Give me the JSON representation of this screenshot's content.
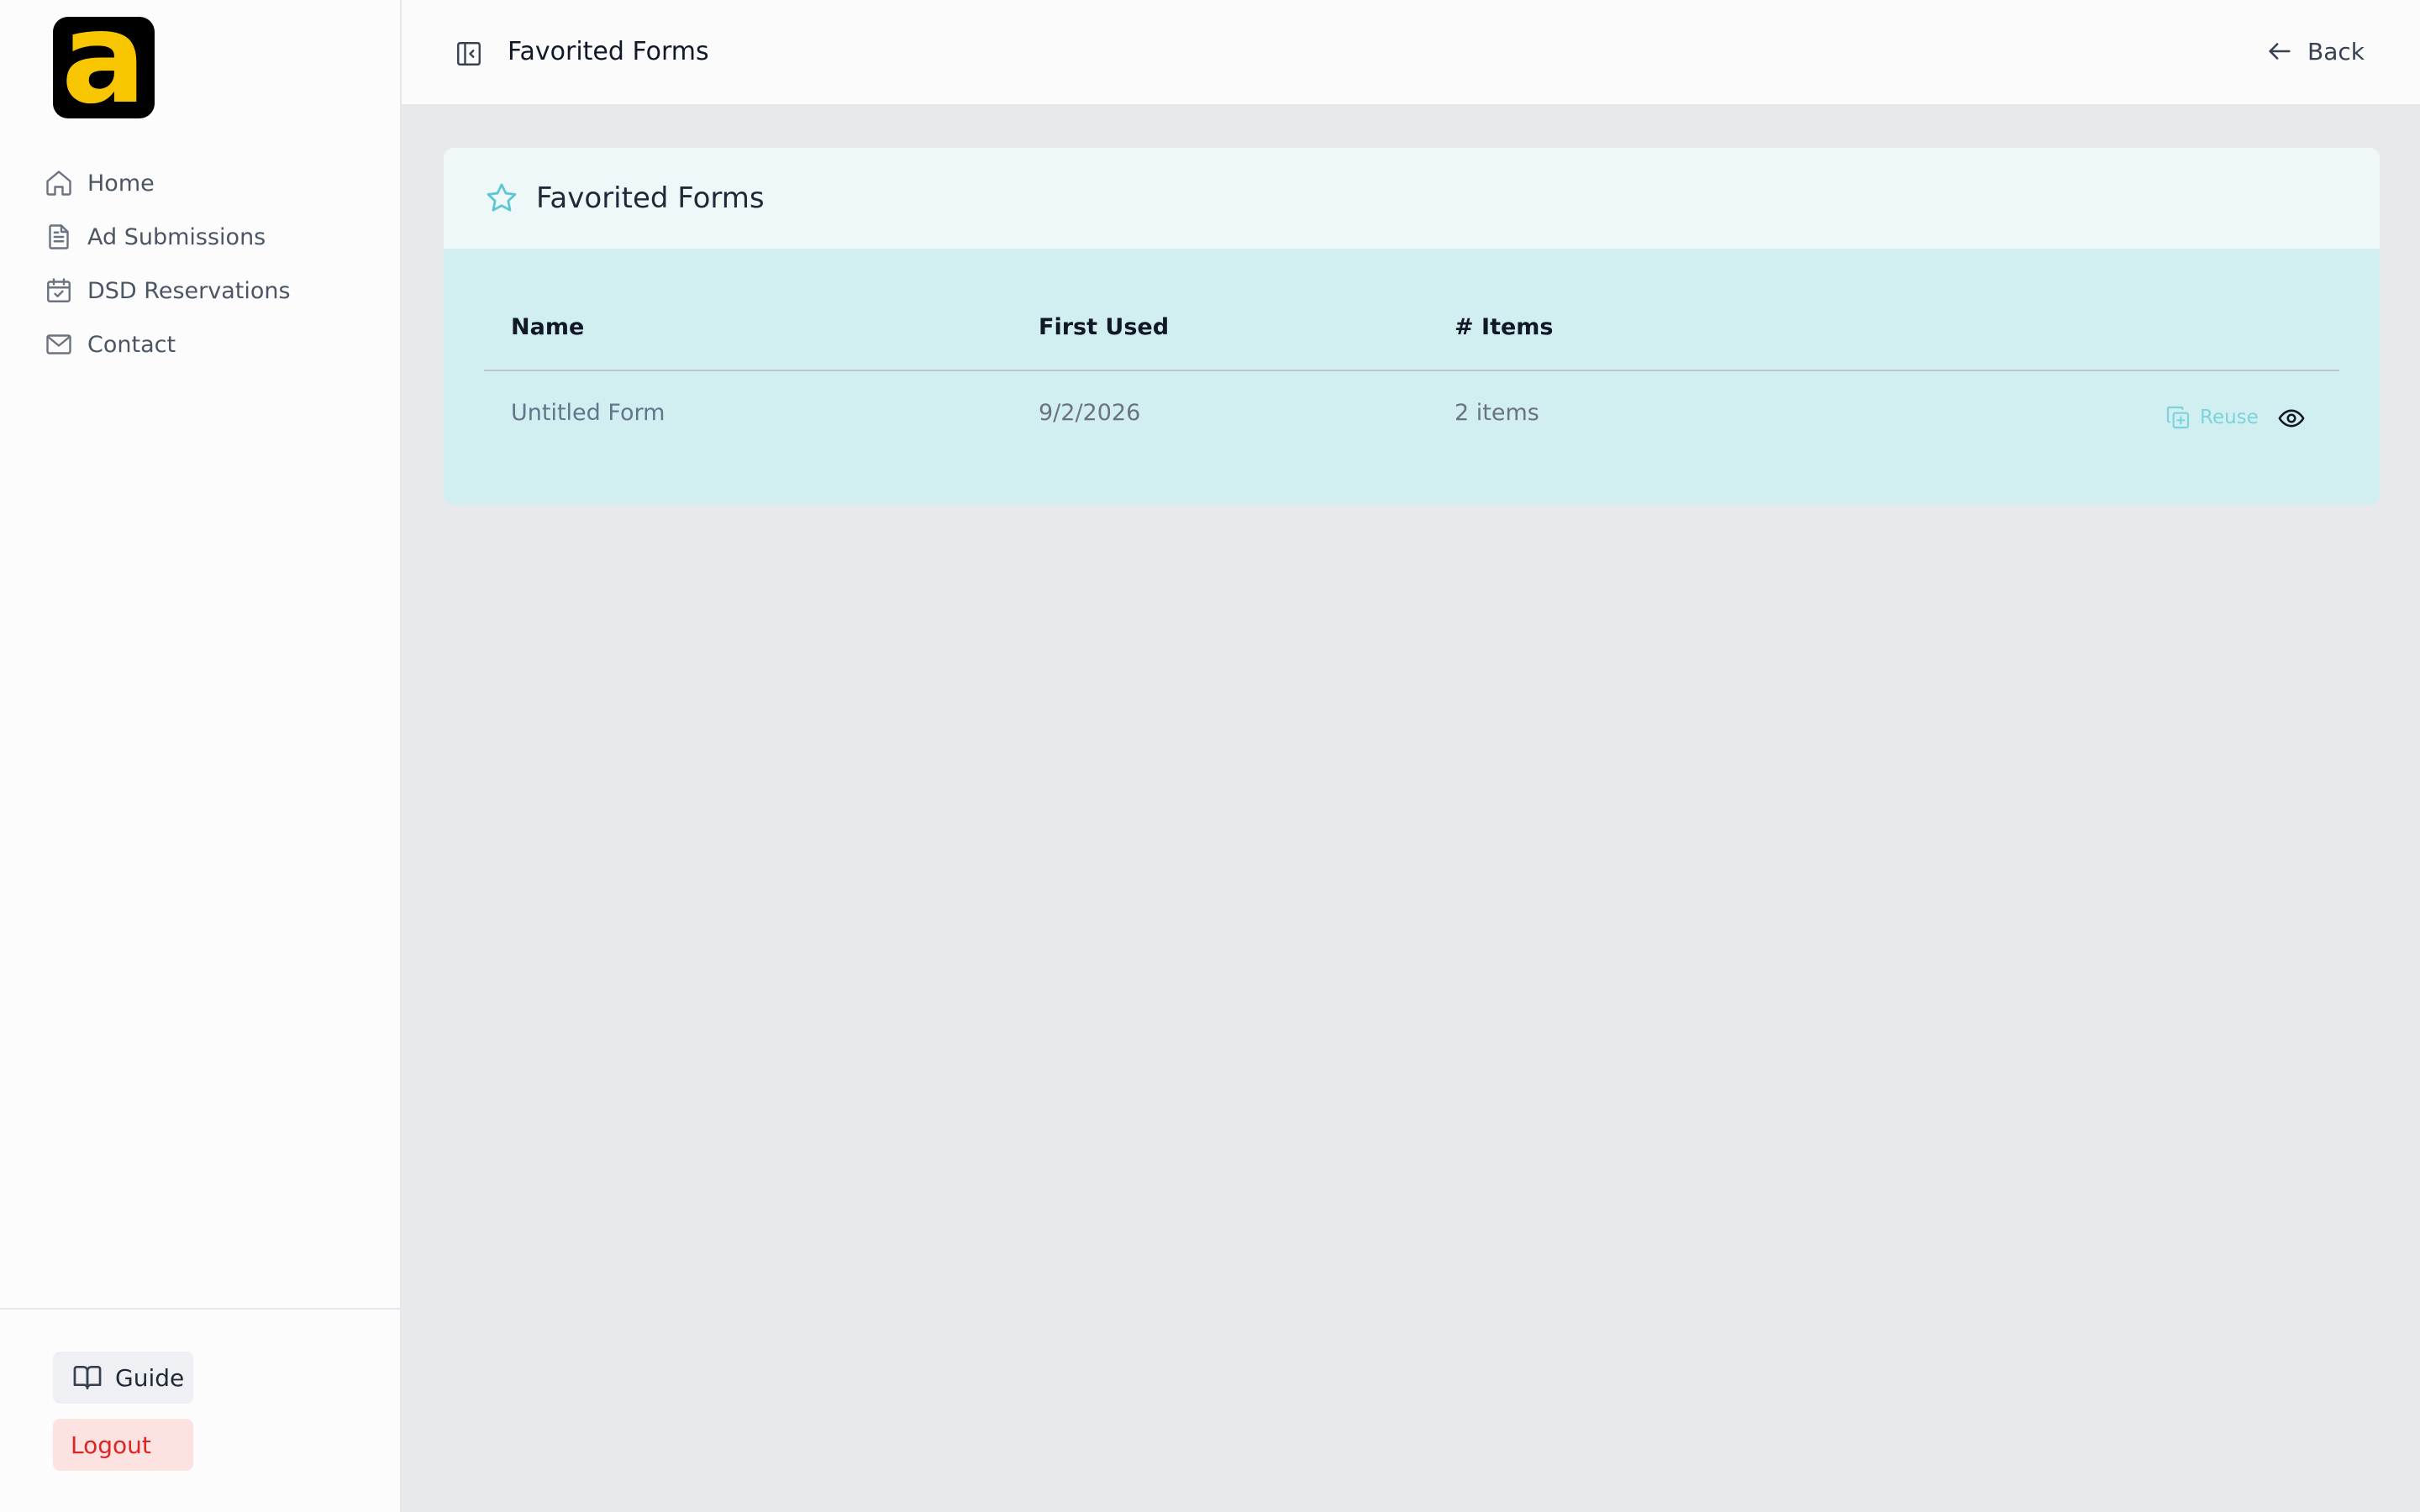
{
  "sidebar": {
    "logo_letter": "a",
    "nav": [
      {
        "label": "Home",
        "icon": "home-icon"
      },
      {
        "label": "Ad Submissions",
        "icon": "document-icon"
      },
      {
        "label": "DSD Reservations",
        "icon": "calendar-check-icon"
      },
      {
        "label": "Contact",
        "icon": "mail-icon"
      }
    ],
    "guide_label": "Guide",
    "logout_label": "Logout"
  },
  "topbar": {
    "title": "Favorited Forms",
    "back_label": "Back"
  },
  "card": {
    "title": "Favorited Forms",
    "columns": [
      "Name",
      "First Used",
      "# Items"
    ],
    "rows": [
      {
        "name": "Untitled Form",
        "first_used": "9/2/2026",
        "items": "2 items",
        "reuse_label": "Reuse"
      }
    ]
  },
  "colors": {
    "logo_bg": "#000000",
    "logo_letter": "#f7c600",
    "accent": "#7dd3dc",
    "card_body": "#d1eef1",
    "card_header": "#eff8f9",
    "logout_text": "#dc2626",
    "logout_bg": "#fde2e2"
  }
}
